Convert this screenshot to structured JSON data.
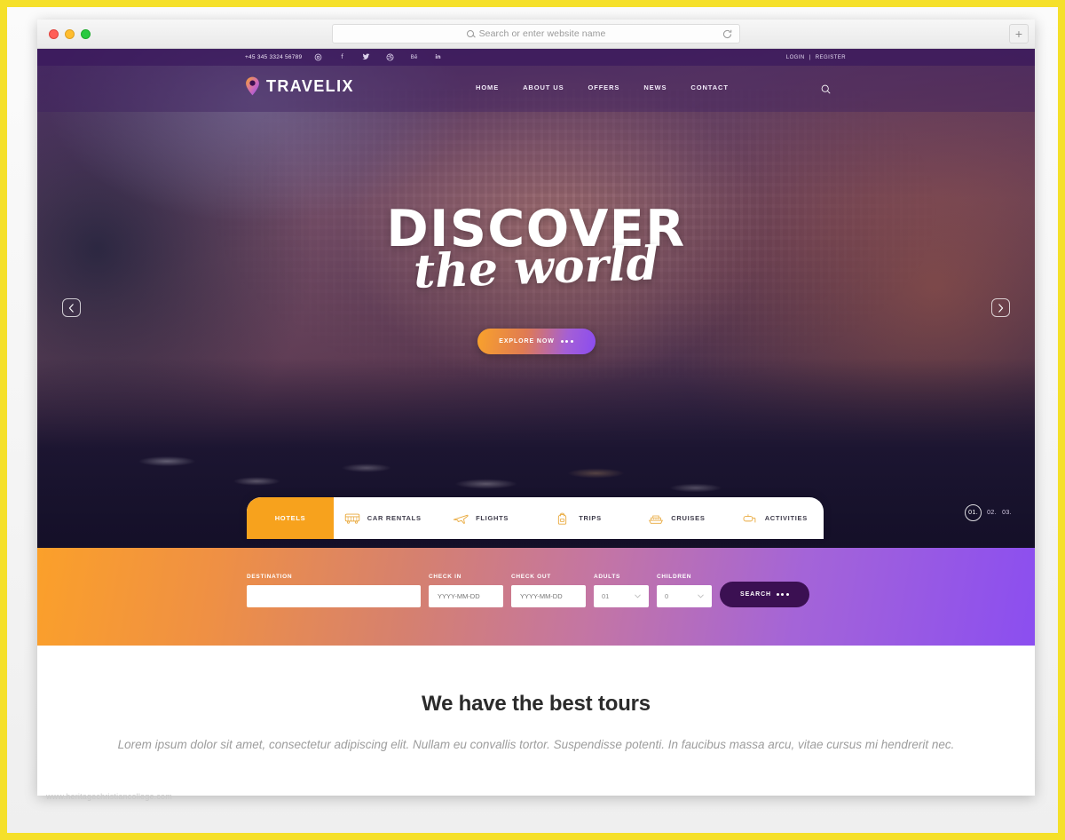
{
  "browser": {
    "omnibox_placeholder": "Search or enter website name",
    "reload_icon": "reload-icon",
    "newtab_label": "+",
    "traffic_lights": [
      "close",
      "minimize",
      "maximize"
    ]
  },
  "topbar": {
    "phone": "+45 345 3324 56789",
    "socials": [
      {
        "name": "instagram-icon",
        "glyph": "◎"
      },
      {
        "name": "facebook-icon",
        "glyph": "f"
      },
      {
        "name": "twitter-icon",
        "glyph": "🐦"
      },
      {
        "name": "dribbble-icon",
        "glyph": "◉"
      },
      {
        "name": "behance-icon",
        "glyph": "Bē"
      },
      {
        "name": "linkedin-icon",
        "glyph": "in"
      }
    ],
    "login_label": "LOGIN",
    "divider": "|",
    "register_label": "REGISTER"
  },
  "nav": {
    "logo_text": "TRAVELIX",
    "logo_icon": "map-pin-icon",
    "items": [
      {
        "label": "HOME"
      },
      {
        "label": "ABOUT US"
      },
      {
        "label": "OFFERS"
      },
      {
        "label": "NEWS"
      },
      {
        "label": "CONTACT"
      }
    ],
    "search_icon": "search-icon"
  },
  "hero": {
    "title": "DISCOVER",
    "subtitle": "the world",
    "cta_label": "EXPLORE NOW",
    "prev_icon": "chevron-left-icon",
    "next_icon": "chevron-right-icon",
    "slides": [
      {
        "num": "01.",
        "active": true
      },
      {
        "num": "02.",
        "active": false
      },
      {
        "num": "03.",
        "active": false
      }
    ]
  },
  "tabs": [
    {
      "label": "HOTELS",
      "icon": "hotel-icon",
      "active": true
    },
    {
      "label": "CAR RENTALS",
      "icon": "bus-icon",
      "active": false
    },
    {
      "label": "FLIGHTS",
      "icon": "plane-icon",
      "active": false
    },
    {
      "label": "TRIPS",
      "icon": "backpack-icon",
      "active": false
    },
    {
      "label": "CRUISES",
      "icon": "ship-icon",
      "active": false
    },
    {
      "label": "ACTIVITIES",
      "icon": "snorkel-icon",
      "active": false
    }
  ],
  "booking": {
    "destination_label": "DESTINATION",
    "destination_value": "",
    "destination_placeholder": "",
    "checkin_label": "CHECK IN",
    "checkin_placeholder": "YYYY-MM-DD",
    "checkout_label": "CHECK OUT",
    "checkout_placeholder": "YYYY-MM-DD",
    "adults_label": "ADULTS",
    "adults_value": "01",
    "children_label": "CHILDREN",
    "children_value": "0",
    "search_label": "SEARCH"
  },
  "tours": {
    "title": "We have the best tours",
    "subtitle": "Lorem ipsum dolor sit amet, consectetur adipiscing elit. Nullam eu convallis tortor. Suspendisse potenti. In faucibus massa arcu, vitae cursus mi hendrerit nec.",
    "cards": [
      {
        "name": "tour-card-1"
      },
      {
        "name": "tour-card-2"
      },
      {
        "name": "tour-card-3"
      }
    ]
  },
  "watermark": "www.heritagechristiancollege.com",
  "colors": {
    "accent_orange": "#F7A21D",
    "accent_purple": "#8B4EF0",
    "brand_deep_purple": "#3B1052",
    "frame_yellow": "#F5E02A",
    "icon_gold": "#E9A93C"
  }
}
